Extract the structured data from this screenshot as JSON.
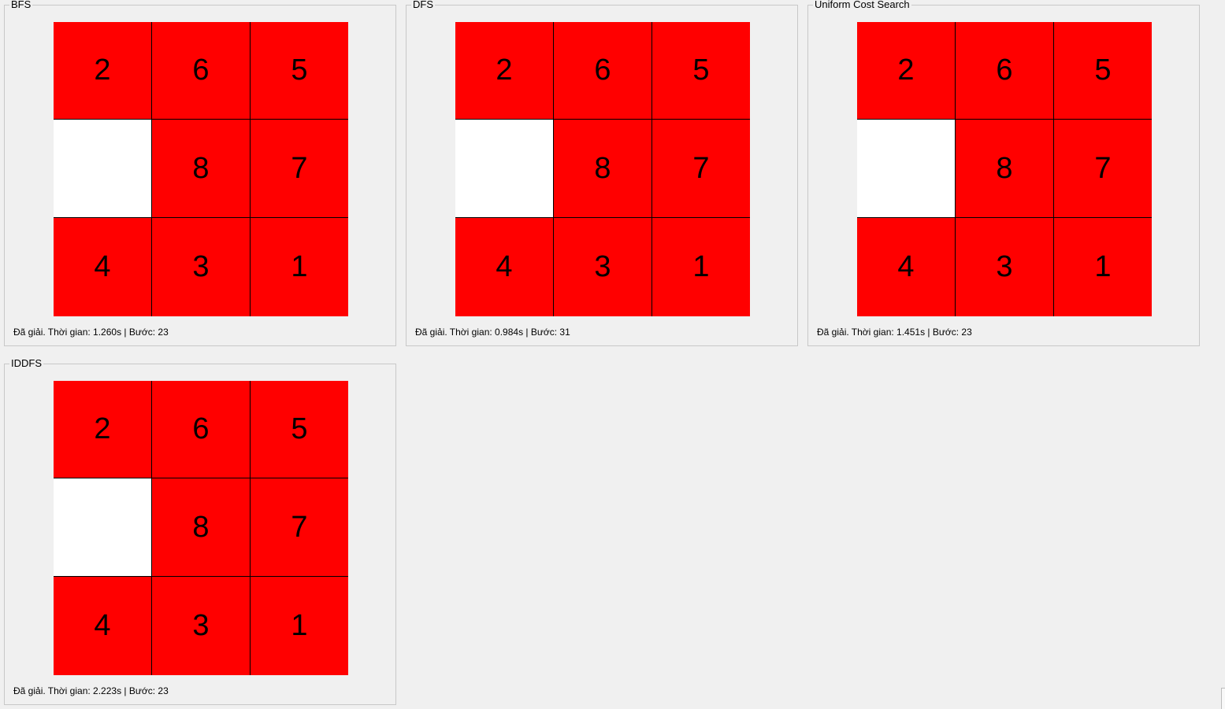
{
  "panels": [
    {
      "title": "BFS",
      "tiles": [
        "2",
        "6",
        "5",
        "",
        "8",
        "7",
        "4",
        "3",
        "1"
      ],
      "status": "Đã giải. Thời gian: 1.260s | Bước: 23"
    },
    {
      "title": "DFS",
      "tiles": [
        "2",
        "6",
        "5",
        "",
        "8",
        "7",
        "4",
        "3",
        "1"
      ],
      "status": "Đã giải. Thời gian: 0.984s | Bước: 31"
    },
    {
      "title": "Uniform Cost Search",
      "tiles": [
        "2",
        "6",
        "5",
        "",
        "8",
        "7",
        "4",
        "3",
        "1"
      ],
      "status": "Đã giải. Thời gian: 1.451s | Bước: 23"
    },
    {
      "title": "IDDFS",
      "tiles": [
        "2",
        "6",
        "5",
        "",
        "8",
        "7",
        "4",
        "3",
        "1"
      ],
      "status": "Đã giải. Thời gian: 2.223s | Bước: 23"
    }
  ],
  "colors": {
    "tile": "#ff0000",
    "blank_tile": "#ffffff",
    "background": "#f0f0f0"
  }
}
